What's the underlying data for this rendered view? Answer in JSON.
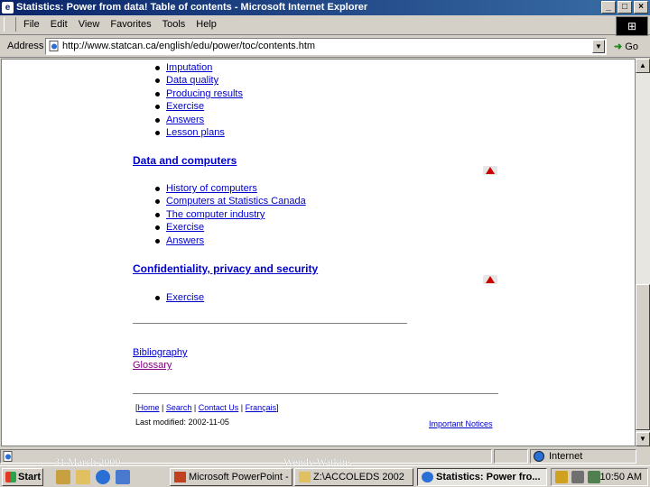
{
  "window": {
    "title": "Statistics: Power from data! Table of contents - Microsoft Internet Explorer",
    "minimize": "_",
    "maximize": "□",
    "close": "×"
  },
  "menu": [
    "File",
    "Edit",
    "View",
    "Favorites",
    "Tools",
    "Help"
  ],
  "address": {
    "label": "Address",
    "url": "http://www.statcan.ca/english/edu/power/toc/contents.htm",
    "go_label": "Go"
  },
  "page": {
    "list1": [
      "Imputation",
      "Data quality",
      "Producing results",
      "Exercise",
      "Answers",
      "Lesson plans"
    ],
    "section2_title": "Data and computers",
    "list2": [
      "History of computers",
      "Computers at Statistics Canada",
      "The computer industry",
      "Exercise",
      "Answers"
    ],
    "section3_title": "Confidentiality, privacy and security",
    "list3": [
      "Exercise"
    ],
    "bibliography": "Bibliography",
    "glossary": "Glossary",
    "footer": {
      "home": "Home",
      "search": "Search",
      "contact": "Contact Us",
      "francais": "Français",
      "last_modified": "Last modified: 2002-11-05",
      "notices": "Important Notices"
    }
  },
  "status": {
    "zone": "Internet"
  },
  "slide_footer": {
    "date": "31 March 2000",
    "author": "Wendy Watkins"
  },
  "taskbar": {
    "start": "Start",
    "tasks": [
      "Microsoft PowerPoint - [...",
      "Z:\\ACCOLEDS 2002",
      "Statistics: Power fro..."
    ],
    "clock": "10:50 AM"
  }
}
